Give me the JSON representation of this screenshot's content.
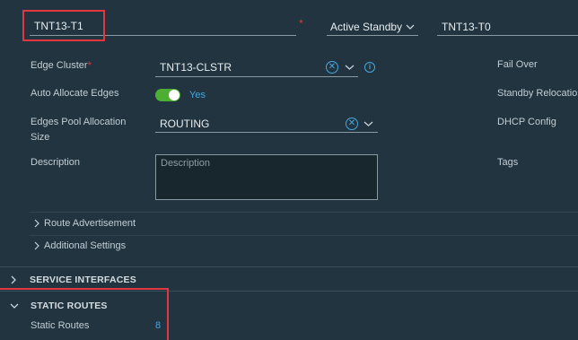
{
  "header": {
    "name_value": "TNT13-T1",
    "required_mark": "*",
    "ha_mode_value": "Active Standby",
    "linked_tier0_value": "TNT13-T0"
  },
  "form": {
    "edge_cluster_label": "Edge Cluster",
    "edge_cluster_required": "*",
    "edge_cluster_value": "TNT13-CLSTR",
    "info_icon_glyph": "i",
    "auto_allocate_label": "Auto Allocate Edges",
    "auto_allocate_value": "Yes",
    "auto_allocate_on": true,
    "pool_allocation_label_line1": "Edges Pool Allocation",
    "pool_allocation_label_line2": "Size",
    "pool_allocation_value": "ROUTING",
    "description_label": "Description",
    "description_placeholder": "Description",
    "clear_glyph": "✕"
  },
  "right_column": {
    "fail_over_label": "Fail Over",
    "standby_relocation_label": "Standby Relocatio",
    "dhcp_config_label": "DHCP Config",
    "tags_label": "Tags"
  },
  "collapsibles": {
    "route_advertisement": "Route Advertisement",
    "additional_settings": "Additional Settings"
  },
  "sections": {
    "service_interfaces": "SERVICE INTERFACES",
    "static_routes": "STATIC ROUTES",
    "static_routes_row_label": "Static Routes",
    "static_routes_count": "8"
  },
  "colors": {
    "background": "#21343f",
    "accent_blue": "#49a7dd",
    "toggle_green": "#4cae33",
    "highlight_red": "#e0383e"
  }
}
